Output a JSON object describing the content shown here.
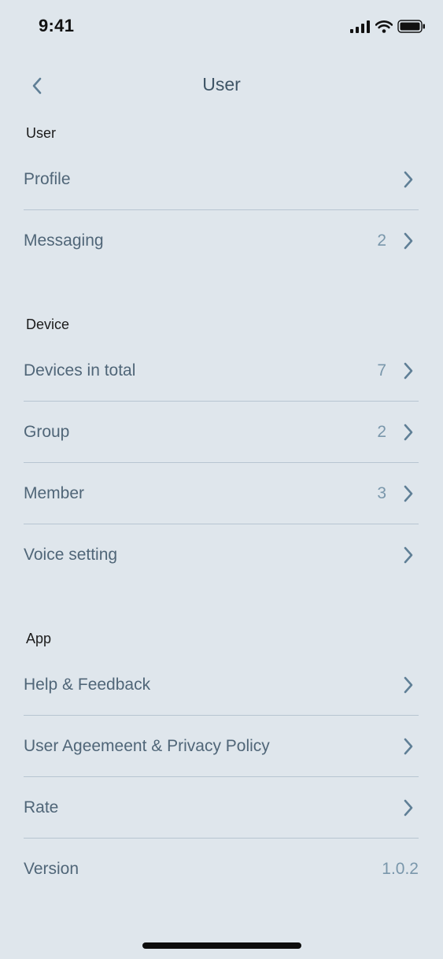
{
  "status_bar": {
    "time": "9:41"
  },
  "nav": {
    "title": "User"
  },
  "sections": {
    "user": {
      "header": "User",
      "profile_label": "Profile",
      "messaging_label": "Messaging",
      "messaging_count": "2"
    },
    "device": {
      "header": "Device",
      "devices_label": "Devices in total",
      "devices_count": "7",
      "group_label": "Group",
      "group_count": "2",
      "member_label": "Member",
      "member_count": "3",
      "voice_label": "Voice setting"
    },
    "app": {
      "header": "App",
      "help_label": "Help & Feedback",
      "agreement_label": "User Ageemeent & Privacy Policy",
      "rate_label": "Rate",
      "version_label": "Version",
      "version_value": "1.0.2"
    }
  },
  "icons": {
    "back": "chevron-left-icon",
    "row": "chevron-right-icon",
    "signal": "cellular-signal-icon",
    "wifi": "wifi-icon",
    "battery": "battery-icon"
  },
  "colors": {
    "background": "#dfe6ec",
    "accent": "#5f7f96",
    "divider": "#b7c5d1"
  }
}
